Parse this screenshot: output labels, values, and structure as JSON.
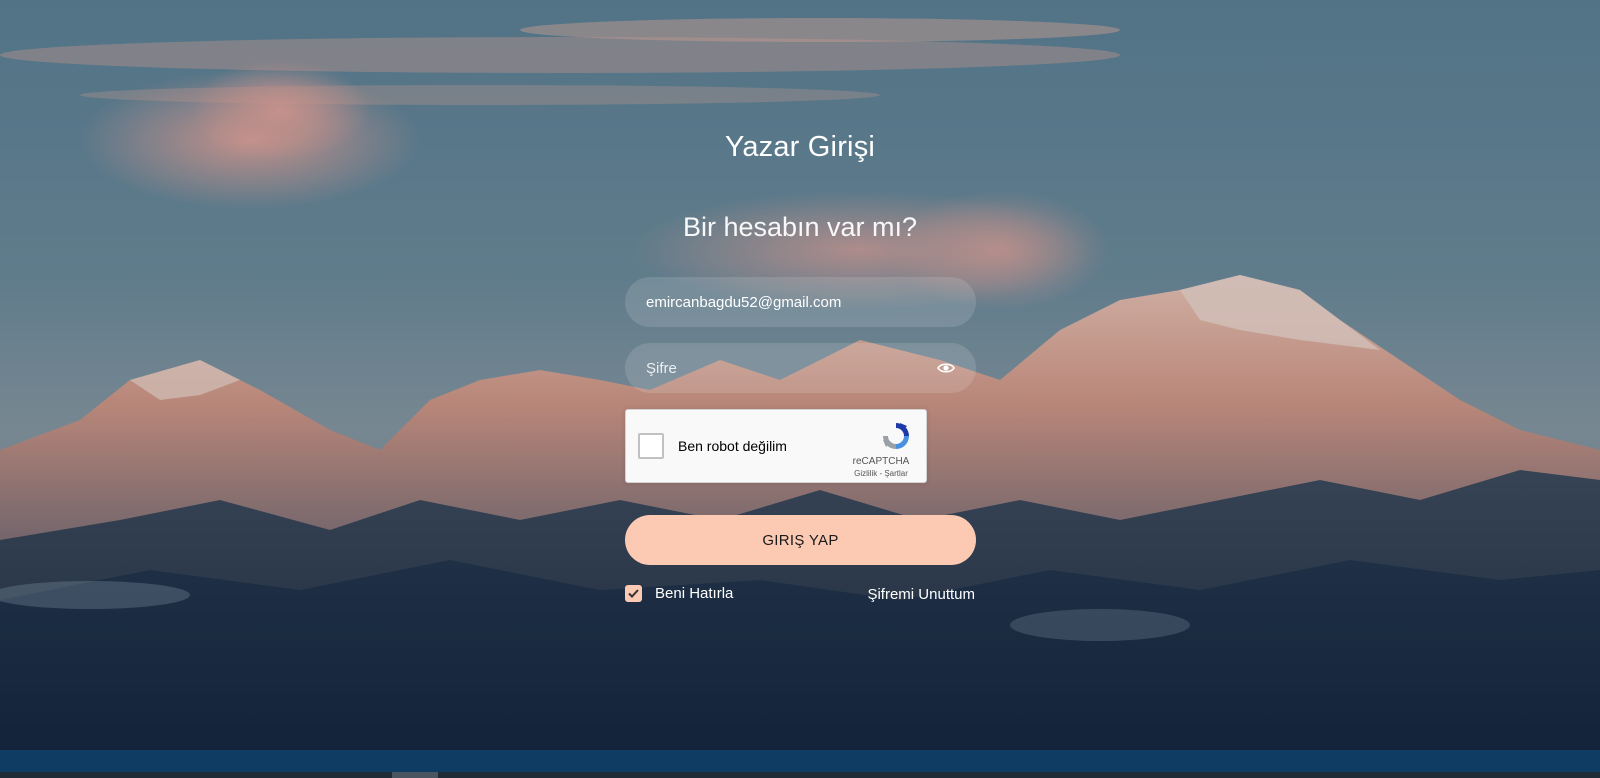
{
  "page": {
    "title": "Yazar Girişi",
    "subtitle": "Bir hesabın var mı?"
  },
  "form": {
    "email_value": "emircanbagdu52@gmail.com",
    "password_placeholder": "Şifre",
    "login_button_label": "GIRIŞ YAP",
    "remember_label": "Beni Hatırla",
    "remember_checked": true,
    "forgot_label": "Şifremi Unuttum"
  },
  "recaptcha": {
    "label": "Ben robot değilim",
    "brand": "reCAPTCHA",
    "terms": "Gizlilik - Şartlar"
  },
  "icons": {
    "password_toggle": "eye-icon",
    "captcha_logo": "recaptcha-logo-icon",
    "remember_check": "check-icon"
  },
  "colors": {
    "accent": "#fccab3",
    "field_bg": "rgba(255,255,255,0.13)",
    "text": "#ffffff",
    "bottom_bar": "#0f3c62"
  }
}
